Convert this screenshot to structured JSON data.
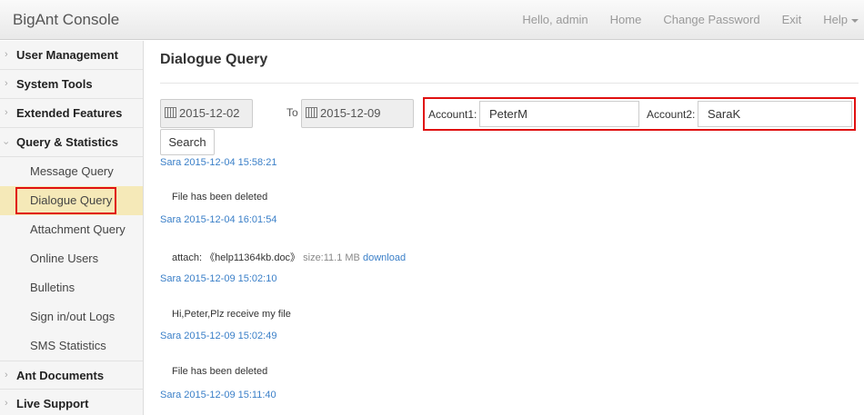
{
  "app": {
    "title": "BigAnt Console"
  },
  "nav": {
    "greeting": "Hello, admin",
    "home": "Home",
    "change_password": "Change Password",
    "exit": "Exit",
    "help": "Help"
  },
  "sidebar": {
    "groups": [
      {
        "label": "User Management"
      },
      {
        "label": "System Tools"
      },
      {
        "label": "Extended Features"
      },
      {
        "label": "Query & Statistics"
      },
      {
        "label": "Ant Documents"
      },
      {
        "label": "Live Support"
      }
    ],
    "subitems": [
      {
        "label": "Message Query"
      },
      {
        "label": "Dialogue Query"
      },
      {
        "label": "Attachment Query"
      },
      {
        "label": "Online Users"
      },
      {
        "label": "Bulletins"
      },
      {
        "label": "Sign in/out Logs"
      },
      {
        "label": "SMS Statistics"
      }
    ]
  },
  "page": {
    "title": "Dialogue Query"
  },
  "filters": {
    "date_from": "2015-12-02",
    "to_label": "To",
    "date_to": "2015-12-09",
    "account1_label": "Account1:",
    "account1_value": "PeterM",
    "account2_label": "Account2:",
    "account2_value": "SaraK",
    "search_label": "Search"
  },
  "messages": [
    {
      "meta": "Sara 2015-12-04 15:58:21",
      "body": "File has been deleted"
    },
    {
      "meta": "Sara 2015-12-04 16:01:54",
      "attach_prefix": "attach: 《help11364kb.doc》",
      "size": "size:11.1 MB",
      "download": "download"
    },
    {
      "meta": "Sara 2015-12-09 15:02:10",
      "body": "Hi,Peter,Plz receive my file"
    },
    {
      "meta": "Sara 2015-12-09 15:02:49",
      "body": "File has been deleted"
    },
    {
      "meta": "Sara 2015-12-09 15:11:40"
    }
  ],
  "colors": {
    "highlight_border": "#e01010",
    "link": "#3a7fc8",
    "active_bg": "#f5e9b8"
  }
}
